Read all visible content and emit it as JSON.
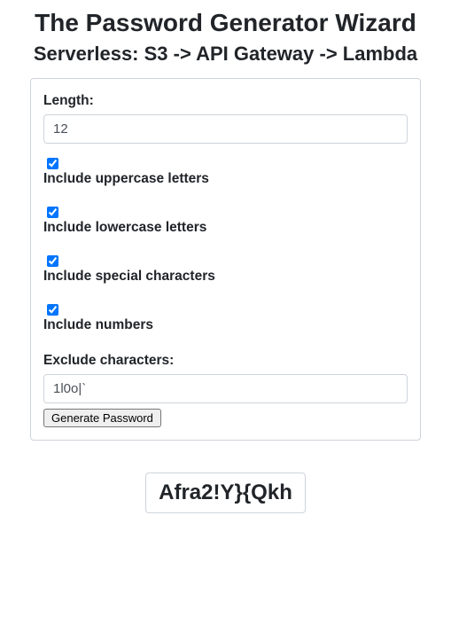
{
  "title": "The Password Generator Wizard",
  "subtitle": "Serverless: S3 -> API Gateway -> Lambda",
  "form": {
    "length": {
      "label": "Length:",
      "value": "12"
    },
    "uppercase": {
      "label": "Include uppercase letters",
      "checked": true
    },
    "lowercase": {
      "label": "Include lowercase letters",
      "checked": true
    },
    "special": {
      "label": "Include special characters",
      "checked": true
    },
    "numbers": {
      "label": "Include numbers",
      "checked": true
    },
    "exclude": {
      "label": "Exclude characters:",
      "value": "1l0o|`"
    },
    "submit_label": "Generate Password"
  },
  "result": "Afra2!Y}{Qkh"
}
